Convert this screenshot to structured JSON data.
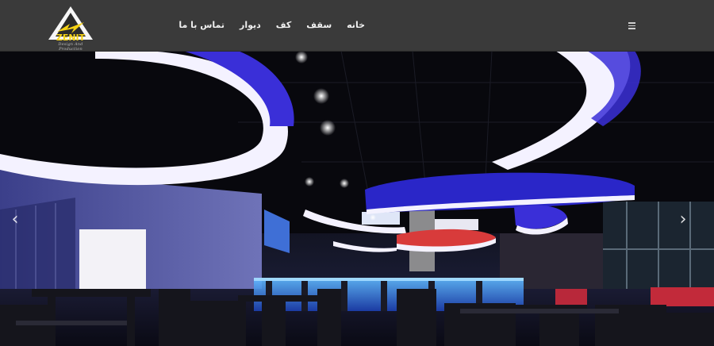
{
  "logo": {
    "brand": "ZENIT",
    "tagline": "Design And Production"
  },
  "nav": {
    "items": [
      {
        "label": "خانه"
      },
      {
        "label": "سقف"
      },
      {
        "label": "کف"
      },
      {
        "label": "دیوار"
      },
      {
        "label": "تماس با ما"
      }
    ]
  },
  "slider": {
    "prev_icon": "chevron-left-icon",
    "next_icon": "chevron-right-icon",
    "prev_glyph": "‹",
    "next_glyph": "›"
  },
  "colors": {
    "header_bg": "#3a3a3a",
    "nav_text": "#f0f0f0",
    "logo_yellow": "#f5d215",
    "ring_glow": "#f3f1ff",
    "ring_blue": "#3a2fd8"
  }
}
